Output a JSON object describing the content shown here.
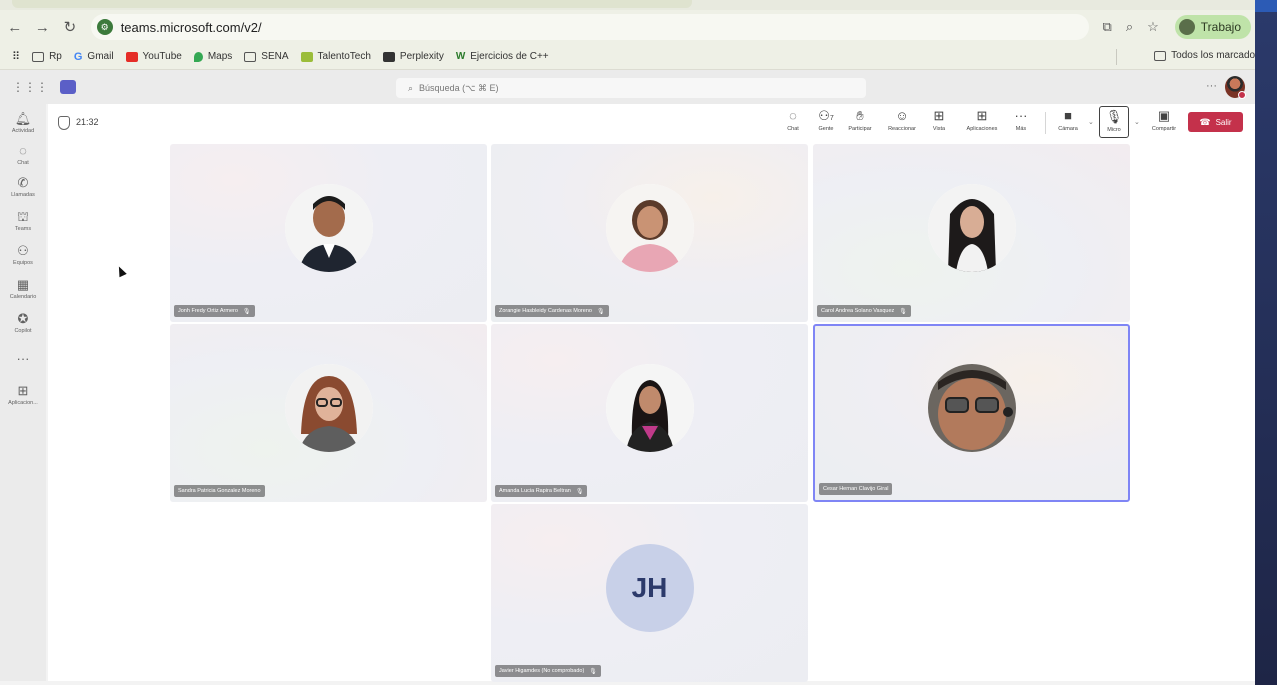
{
  "browser": {
    "url": "teams.microsoft.com/v2/",
    "profile_label": "Trabajo",
    "bookmarks": [
      "Rp",
      "Gmail",
      "YouTube",
      "Maps",
      "SENA",
      "TalentoTech",
      "Perplexity",
      "Ejercicios de C++"
    ],
    "all_bookmarks": "Todos los marcadores"
  },
  "teams": {
    "search_placeholder": "Búsqueda (⌥ ⌘ E)",
    "rail": [
      "Actividad",
      "Chat",
      "Llamadas",
      "Teams",
      "Equipos",
      "Calendario",
      "Copilot",
      "",
      "Aplicacion..."
    ],
    "meeting": {
      "timer": "21:32",
      "toolbar": {
        "chat": "Chat",
        "people": "Gente",
        "people_count": "7",
        "raise": "Participar",
        "react": "Reaccionar",
        "view": "Vista",
        "apps": "Aplicaciones",
        "more": "Más",
        "camera": "Cámara",
        "mic": "Micro",
        "share": "Compartir",
        "leave": "Salir"
      },
      "participants": [
        {
          "name": "Jonh Fredy Ortiz Armero",
          "muted": true
        },
        {
          "name": "Zorangie Hasbleidy Cardenas Moreno",
          "muted": true
        },
        {
          "name": "Carol Andrea Solano Vasquez",
          "muted": true
        },
        {
          "name": "Sandra Patricia Gonzalez Moreno",
          "muted": false
        },
        {
          "name": "Amanda Lucia Rapira Beltran",
          "muted": true
        },
        {
          "name": "Cesar Hernan Clavijo Giral",
          "muted": false,
          "active": true
        },
        {
          "name": "Javier Higamdes (No comprobado)",
          "muted": true,
          "initials": "JH"
        }
      ]
    }
  },
  "colors": {
    "teams_brand": "#5b5fc7",
    "leave_red": "#c4314b",
    "active_speaker": "#7f85f5"
  }
}
